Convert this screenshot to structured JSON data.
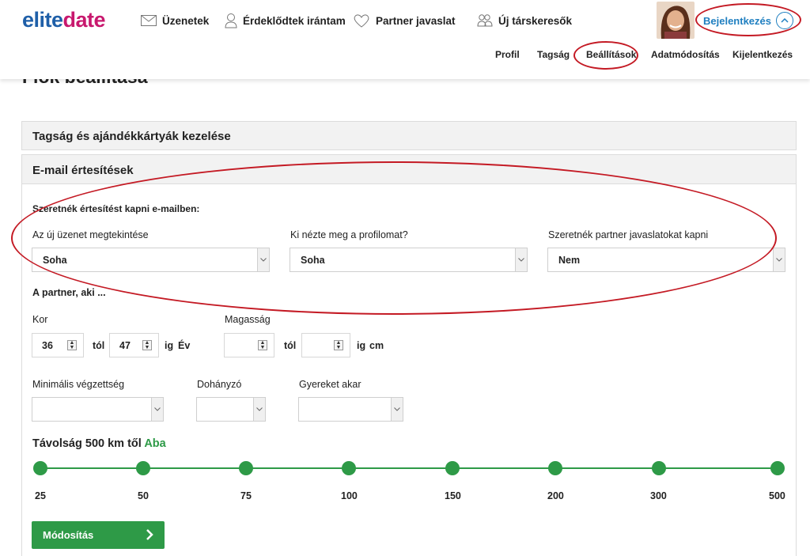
{
  "header": {
    "logo_part1": "elite",
    "logo_part2": "date",
    "nav": [
      {
        "label": "Üzenetek",
        "icon": "envelope-icon"
      },
      {
        "label": "Érdeklődtek irántam",
        "icon": "person-icon"
      },
      {
        "label": "Partner javaslat",
        "icon": "heart-icon"
      },
      {
        "label": "Új társkeresők",
        "icon": "people-icon"
      }
    ],
    "login_label": "Bejelentkezés",
    "subnav": [
      "Profil",
      "Tagság",
      "Beállítások",
      "Adatmódosítás",
      "Kijelentkezés"
    ]
  },
  "page": {
    "title": "Fiók beállítása"
  },
  "panels": {
    "membership": "Tagság és ajándékkártyák kezelése",
    "email": "E-mail értesítések"
  },
  "notifications": {
    "intro": "Szeretnék értesítést kapni e-mailben:",
    "fields": [
      {
        "label": "Az új üzenet megtekintése",
        "value": "Soha"
      },
      {
        "label": "Ki nézte meg a profilomat?",
        "value": "Soha"
      },
      {
        "label": "Szeretnék partner javaslatokat kapni",
        "value": "Nem"
      }
    ]
  },
  "partner": {
    "heading": "A partner, aki ...",
    "age_label": "Kor",
    "age_from": "36",
    "age_to": "47",
    "from_word": "tól",
    "to_word": "ig",
    "age_unit": "Év",
    "height_label": "Magasság",
    "height_from": "",
    "height_to": "",
    "height_unit": "cm",
    "education_label": "Minimális végzettség",
    "smoker_label": "Dohányzó",
    "children_label": "Gyereket akar"
  },
  "distance": {
    "prefix": "Távolság 500 km től",
    "city": "Aba",
    "city_color": "#2e9a47",
    "ticks": [
      "25",
      "50",
      "75",
      "100",
      "150",
      "200",
      "300",
      "500"
    ],
    "selected": "500"
  },
  "submit_label": "Módosítás",
  "colors": {
    "accent_green": "#2e9a47",
    "logo_blue": "#1f5fa8",
    "logo_pink": "#c8186e",
    "link_blue": "#1f7fc0",
    "annotation_red": "#c41a24"
  }
}
